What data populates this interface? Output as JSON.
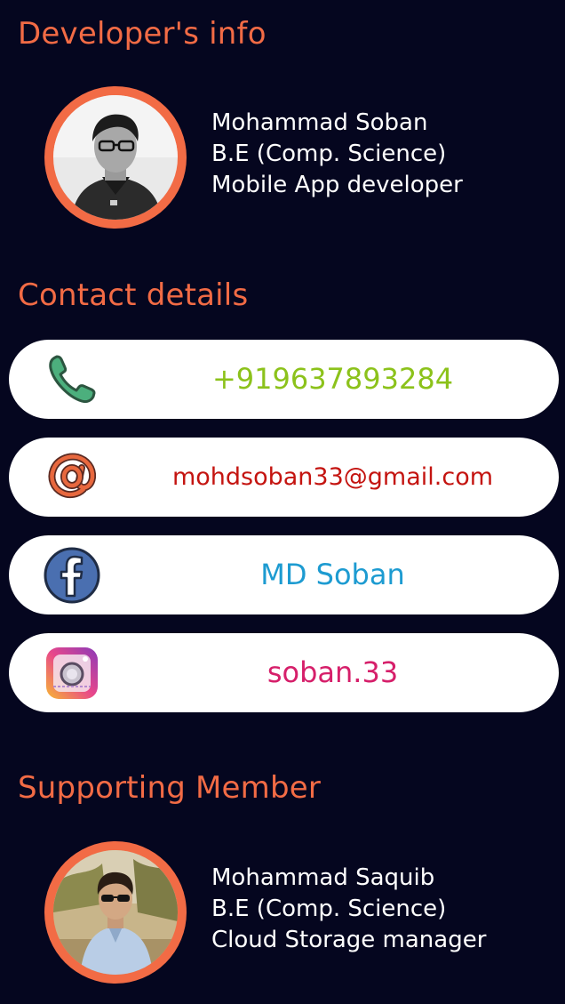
{
  "developer_section": {
    "title": "Developer's info",
    "name": "Mohammad Soban",
    "degree": "B.E (Comp. Science)",
    "role": "Mobile App developer"
  },
  "contact_section": {
    "title": "Contact details",
    "phone": "+919637893284",
    "email": "mohdsoban33@gmail.com",
    "facebook": "MD Soban",
    "instagram": "soban.33"
  },
  "supporting_section": {
    "title": "Supporting Member",
    "name": "Mohammad Saquib",
    "degree": "B.E (Comp. Science)",
    "role": "Cloud Storage manager"
  },
  "colors": {
    "background": "#05061f",
    "accent": "#f26b45",
    "phone_text": "#8cc21b",
    "email_text": "#c41410",
    "facebook_text": "#1d9bd1",
    "instagram_text": "#d61f6a"
  },
  "icons": {
    "phone": "phone-icon",
    "email": "at-sign-icon",
    "facebook": "facebook-icon",
    "instagram": "instagram-icon"
  }
}
